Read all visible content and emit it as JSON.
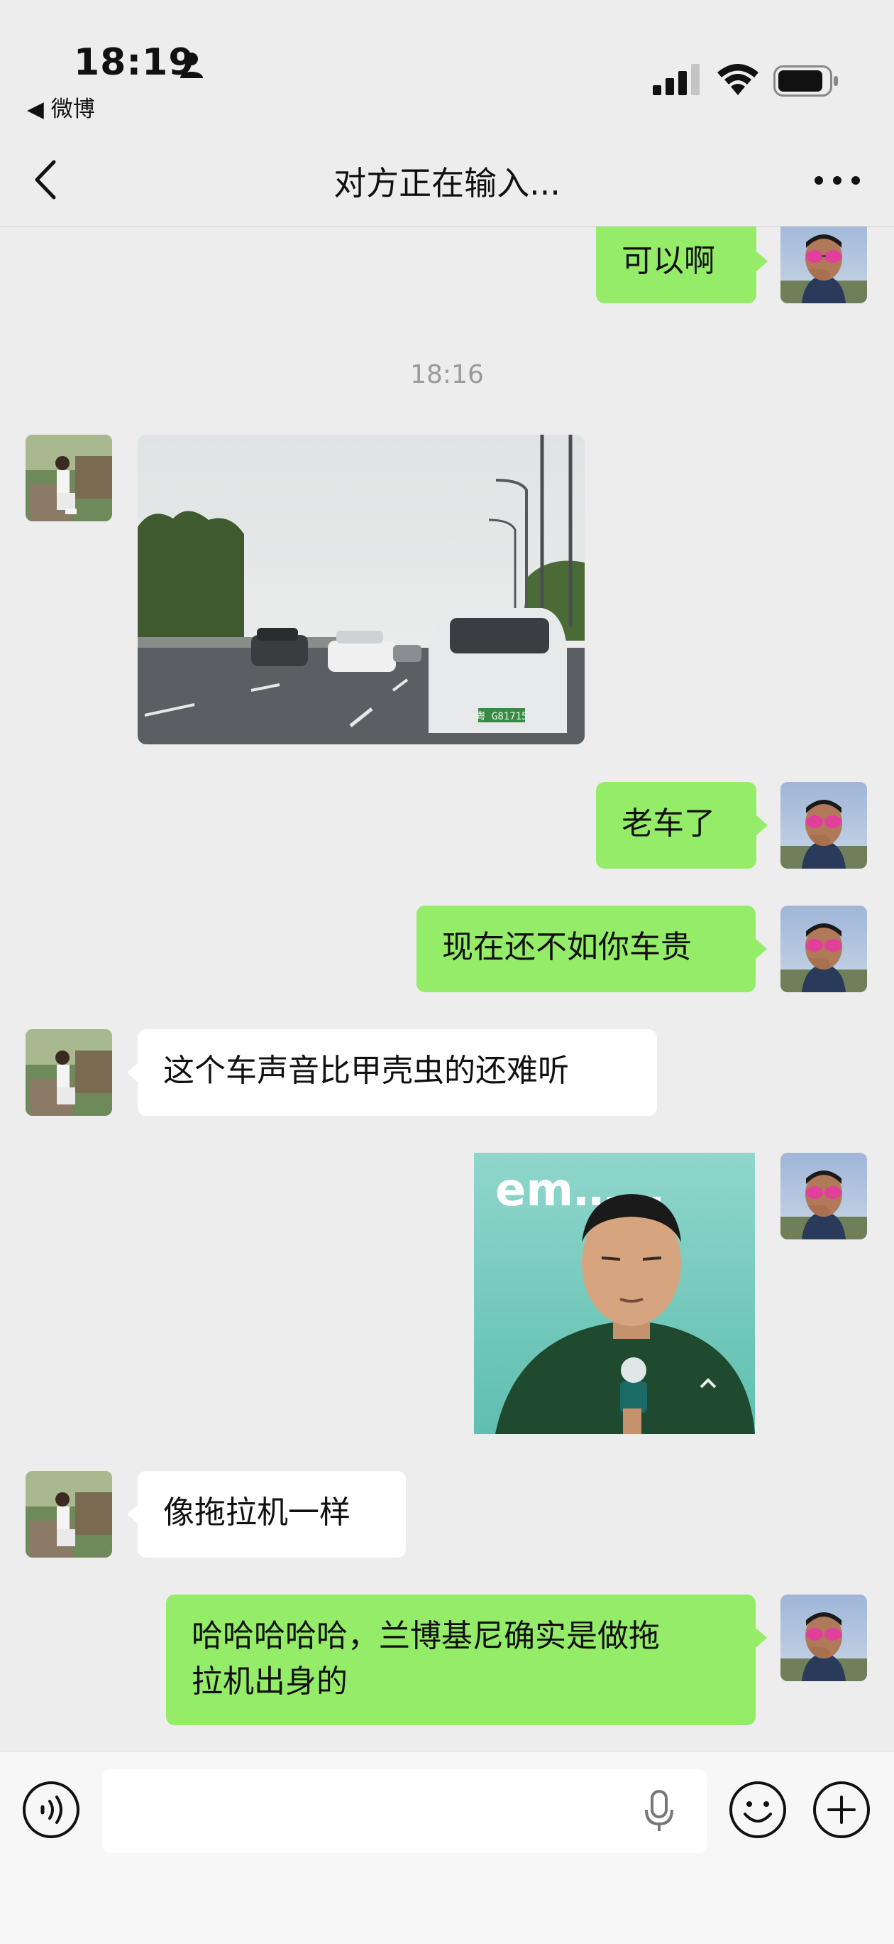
{
  "status_bar": {
    "time": "18:19",
    "back_app": "◀ 微博"
  },
  "nav": {
    "title": "对方正在输入..."
  },
  "messages": [
    {
      "side": "me",
      "type": "text",
      "text": "可以啊"
    },
    {
      "type": "timestamp",
      "text": "18:16"
    },
    {
      "side": "other",
      "type": "photo",
      "photo_text": "粤 G81715"
    },
    {
      "side": "me",
      "type": "text",
      "text": "老车了"
    },
    {
      "side": "me",
      "type": "text",
      "text": "现在还不如你车贵"
    },
    {
      "side": "other",
      "type": "text",
      "text": "这个车声音比甲壳虫的还难听"
    },
    {
      "side": "me",
      "type": "sticker",
      "sticker_text": "em……"
    },
    {
      "side": "other",
      "type": "text",
      "text": "像拖拉机一样"
    },
    {
      "side": "me",
      "type": "text",
      "lines": [
        "哈哈哈哈哈，兰博基尼确实是做拖",
        "拉机出身的"
      ]
    }
  ],
  "input_bar": {
    "placeholder": ""
  },
  "icons": {
    "back": "chevron-left-icon",
    "more": "more-horizontal-icon",
    "voice": "voice-icon",
    "mic": "mic-icon",
    "emoji": "emoji-icon",
    "plus": "plus-icon"
  },
  "colors": {
    "my_bubble": "#95ec69",
    "other_bubble": "#ffffff",
    "background": "#ededed"
  }
}
